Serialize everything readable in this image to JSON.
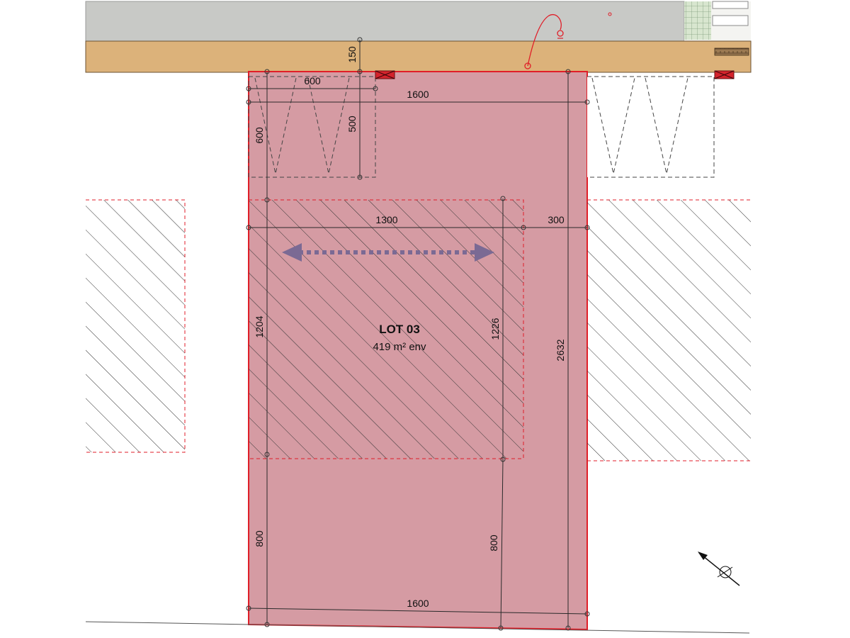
{
  "lot": {
    "title": "LOT 03",
    "area": "419 m² env"
  },
  "dimensions": {
    "frontage_top": "1600",
    "frontage_bottom": "1600",
    "parking_width": "600",
    "parking_depth_left": "600",
    "parking_depth_right": "500",
    "road_setback": "150",
    "building_width": "1300",
    "side_setback": "300",
    "building_depth_left": "1204",
    "building_depth_right": "1226",
    "lot_depth": "2632",
    "rear_setback_left": "800",
    "rear_setback_right": "800"
  },
  "colors": {
    "lot_fill": "#d59ba3",
    "lot_border": "#e01e28",
    "road": "#dcb27a",
    "sidewalk": "#c8c9c6",
    "arrow": "#7b6a94",
    "hatch": "#333333"
  },
  "icons": {
    "north_arrow": "north-arrow-icon",
    "access_marker": "access-marker-icon"
  }
}
